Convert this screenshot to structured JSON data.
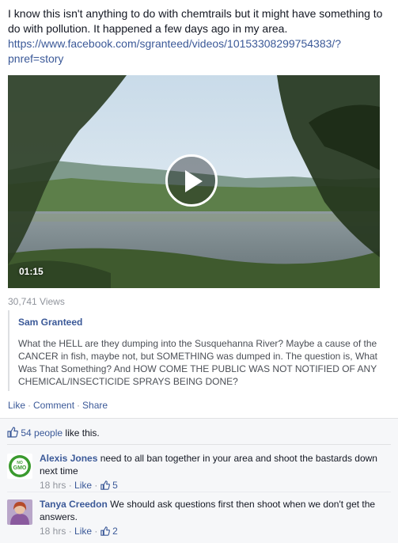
{
  "post": {
    "text": "I know this isn't anything to do with chemtrails but it might have something to do with pollution. It happened a few days ago in my area.",
    "link": "https://www.facebook.com/sgranteed/videos/10153308299754383/?pnref=story"
  },
  "video": {
    "duration": "01:15",
    "views": "30,741 Views"
  },
  "shared": {
    "author": "Sam Granteed",
    "body": "What the HELL are they dumping into the Susquehanna River? Maybe a cause of the CANCER in fish, maybe not, but SOMETHING was dumped in. The question is, What Was That Something? And HOW COME THE PUBLIC WAS NOT NOTIFIED OF ANY CHEMICAL/INSECTICIDE SPRAYS BEING DONE?"
  },
  "actions": {
    "like": "Like",
    "comment": "Comment",
    "share": "Share",
    "separator": "·"
  },
  "likes": {
    "count": "54 people",
    "suffix": " like this."
  },
  "comments": [
    {
      "name": "Alexis Jones",
      "text": "need to all ban together in your area and shoot the bastards down next time",
      "time": "18 hrs",
      "like_label": "Like",
      "like_count": "5",
      "avatar_label_top": "NO",
      "avatar_label_main": "GMO"
    },
    {
      "name": "Tanya Creedon",
      "text": "We should ask questions first then shoot when we don't get the answers.",
      "time": "18 hrs",
      "like_label": "Like",
      "like_count": "2"
    }
  ],
  "colors": {
    "link_blue": "#3b5998",
    "meta_gray": "#90949c",
    "ufi_background": "#f6f7f9",
    "no_gmo_green": "#3a9a2e"
  },
  "icons": {
    "play": "play-icon",
    "thumbs_up": "thumbs-up-icon"
  }
}
